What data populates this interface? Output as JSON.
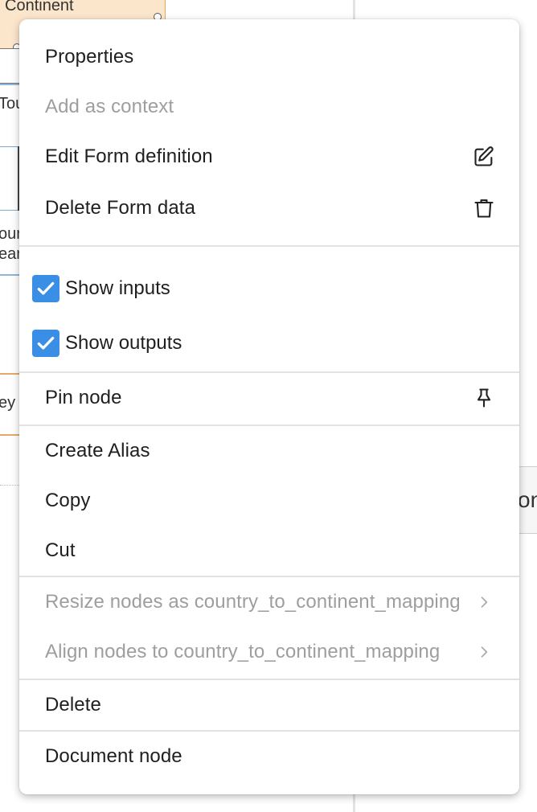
{
  "background": {
    "node_title": "Continent",
    "text_fragments": [
      "Tou",
      "our",
      "ear",
      "ey"
    ],
    "right_fragment": "on"
  },
  "menu": {
    "items": {
      "properties": "Properties",
      "add_context": "Add as context",
      "edit_form": "Edit Form definition",
      "delete_form": "Delete Form data",
      "show_inputs": "Show inputs",
      "show_outputs": "Show outputs",
      "pin_node": "Pin node",
      "create_alias": "Create Alias",
      "copy": "Copy",
      "cut": "Cut",
      "resize_nodes": "Resize nodes as country_to_continent_mapping",
      "align_nodes": "Align nodes to country_to_continent_mapping",
      "delete": "Delete",
      "document_node": "Document node"
    },
    "checks": {
      "show_inputs": true,
      "show_outputs": true
    },
    "icons": {
      "edit_form": "edit-icon",
      "delete_form": "trash-icon",
      "pin_node": "pin-icon",
      "submenu": "chevron-right-icon",
      "checkbox": "checkmark-icon"
    },
    "colors": {
      "checkbox": "#3b8ee6",
      "disabled_text": "#9e9e9e",
      "text": "#1f1f1f"
    }
  }
}
